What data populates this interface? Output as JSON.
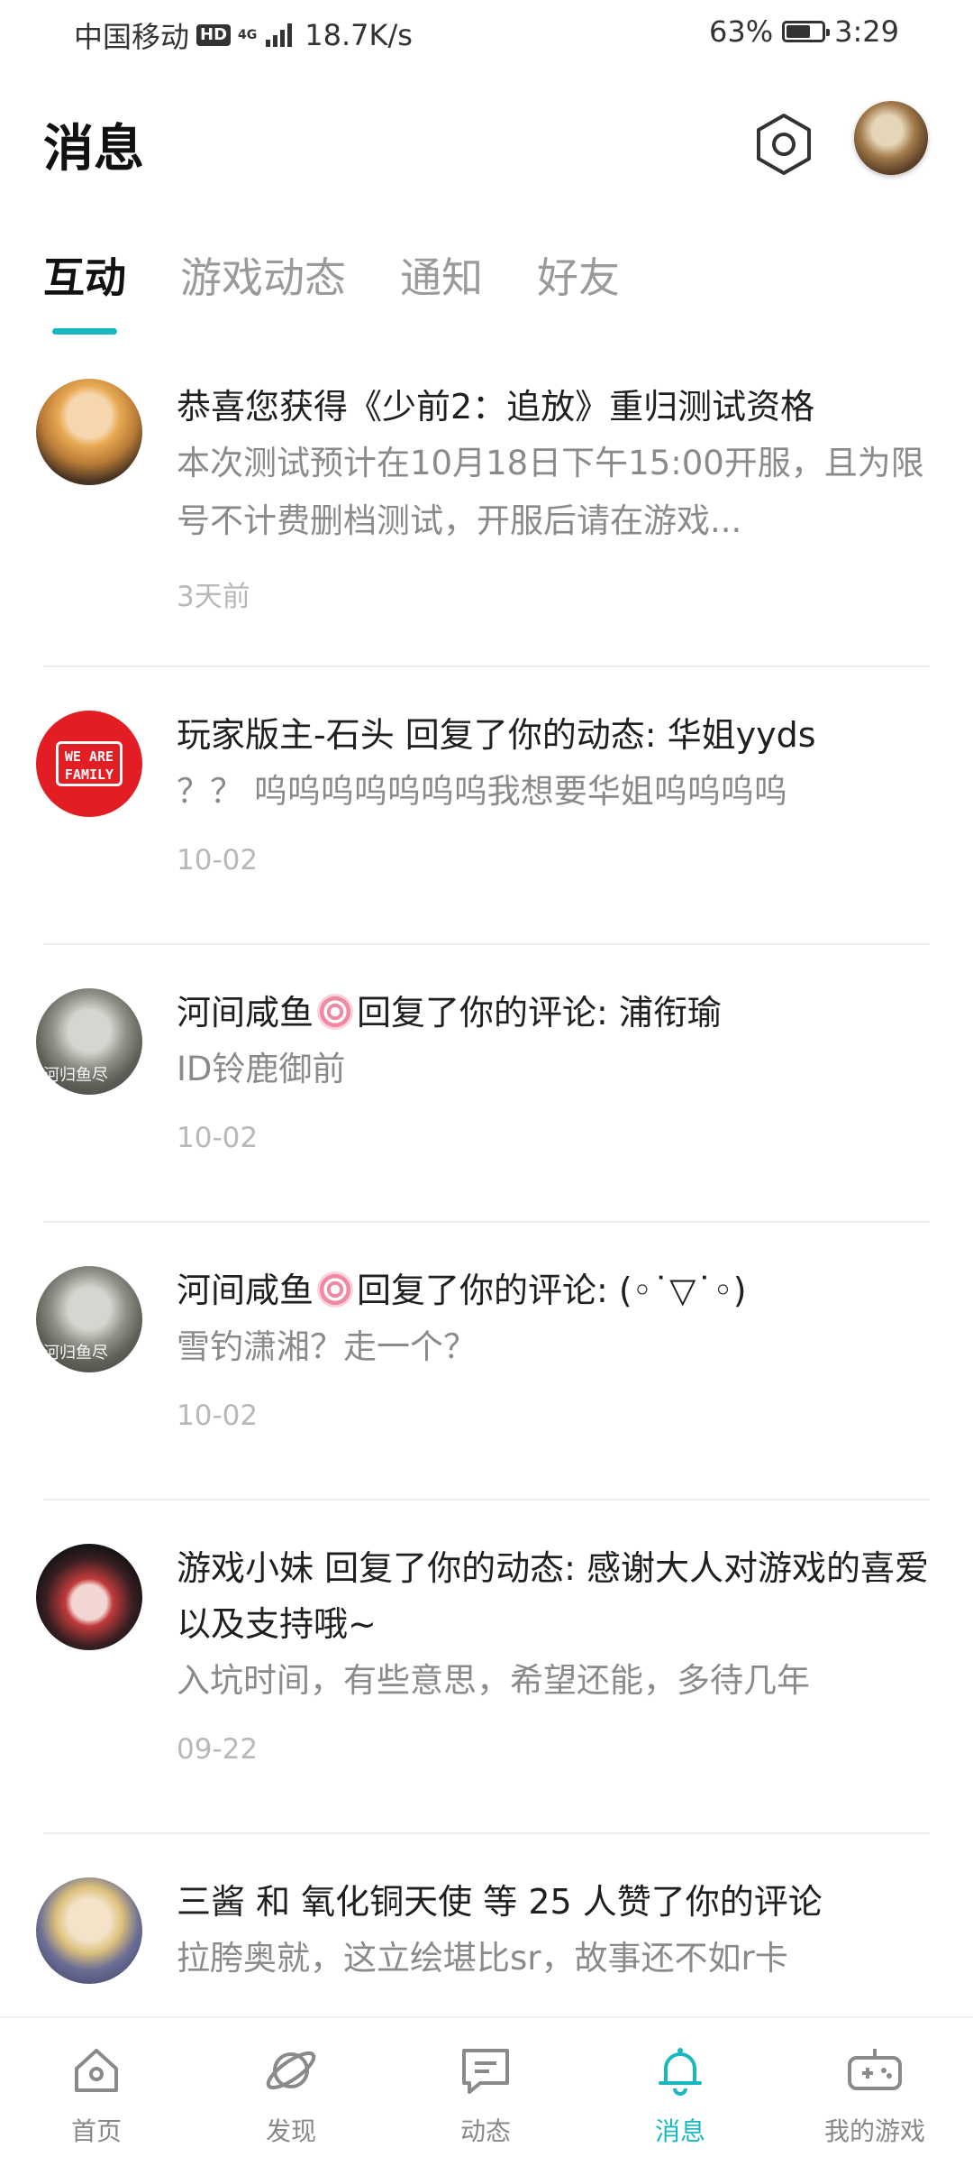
{
  "status_bar": {
    "carrier": "中国移动",
    "hd": "HD",
    "network": "4G",
    "speed": "18.7K/s",
    "battery": "63%",
    "battery_level": 0.63,
    "time": "3:29"
  },
  "header": {
    "title": "消息"
  },
  "tabs": [
    {
      "label": "互动",
      "active": true
    },
    {
      "label": "游戏动态"
    },
    {
      "label": "通知"
    },
    {
      "label": "好友"
    }
  ],
  "messages": [
    {
      "title": "恭喜您获得《少前2：追放》重归测试资格",
      "body": "本次测试预计在10月18日下午15:00开服，且为限号不计费删档测试，开服后请在游戏...",
      "time": "3天前"
    },
    {
      "avatar_text": "WE ARE FAMILY",
      "title": "玩家版主-石头 回复了你的动态: 华姐yyds",
      "body": "？？ 呜呜呜呜呜呜呜我想要华姐呜呜呜呜",
      "time": "10-02"
    },
    {
      "avatar_text": "河归鱼尽",
      "title_name": "河间咸鱼",
      "title_rest": "回复了你的评论: 浦衔瑜",
      "body": "ID铃鹿御前",
      "time": "10-02"
    },
    {
      "avatar_text": "河归鱼尽",
      "title_name": "河间咸鱼",
      "title_rest": "回复了你的评论: (◦˙▽˙◦)",
      "body": "雪钓潇湘？走一个？",
      "time": "10-02"
    },
    {
      "title": "游戏小妹 回复了你的动态: 感谢大人对游戏的喜爱以及支持哦~",
      "body": "入坑时间，有些意思，希望还能，多待几年",
      "time": "09-22"
    },
    {
      "title": "三酱 和 氧化铜天使 等 25 人赞了你的评论",
      "body": "拉胯奥就，这立绘堪比sr，故事还不如r卡"
    }
  ],
  "bottom_nav": [
    {
      "label": "首页",
      "icon": "home-icon"
    },
    {
      "label": "发现",
      "icon": "planet-icon"
    },
    {
      "label": "动态",
      "icon": "chat-icon"
    },
    {
      "label": "消息",
      "icon": "bell-icon",
      "active": true
    },
    {
      "label": "我的游戏",
      "icon": "gamepad-icon"
    }
  ],
  "colors": {
    "accent": "#19b8c0",
    "family_red": "#e21d24"
  }
}
